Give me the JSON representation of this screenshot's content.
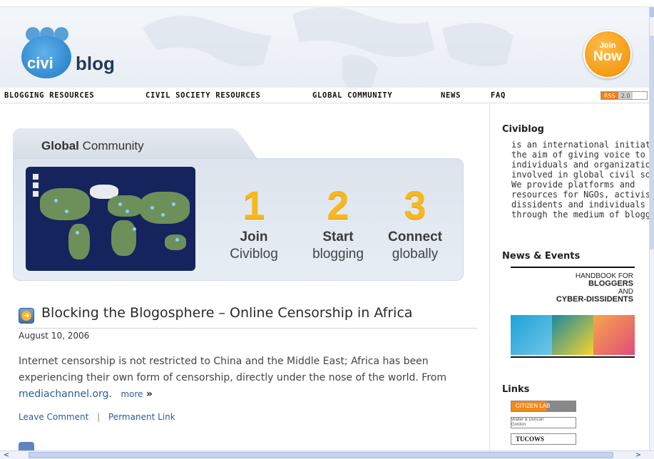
{
  "header": {
    "logo_civi": "civi",
    "logo_blog": "blog",
    "join_top": "Join",
    "join_bottom": "Now"
  },
  "nav": {
    "items": [
      "BLOGGING RESOURCES",
      "CIVIL SOCIETY RESOURCES",
      "GLOBAL COMMUNITY",
      "NEWS",
      "FAQ"
    ],
    "rss_left": "RSS",
    "rss_right": "2.0"
  },
  "global_community": {
    "title_bold": "Global",
    "title_rest": "Community",
    "steps": [
      {
        "num": "1",
        "line1": "Join",
        "line2": "Civiblog"
      },
      {
        "num": "2",
        "line1": "Start",
        "line2": "blogging"
      },
      {
        "num": "3",
        "line1": "Connect",
        "line2": "globally"
      }
    ]
  },
  "post": {
    "title": "Blocking the Blogosphere – Online Censorship in Africa",
    "date": "August 10, 2006",
    "body_before_link": "Internet censorship is not restricted to China and the Middle East; Africa has been experiencing their own form of censorship, directly under the nose of the world. From ",
    "link_text": "mediachannel.org",
    "body_after_link": ".",
    "more": "more",
    "more_arrow": "»",
    "leave_comment": "Leave Comment",
    "separator": "|",
    "permanent_link": "Permanent Link"
  },
  "sidebar": {
    "civiblog_heading": "Civiblog",
    "civiblog_lines": [
      "is an international initiative wi",
      "the aim of giving voice to",
      "individuals and organizations",
      "involved in global civil society",
      "We provide platforms and",
      "resources for NGOs, activists,",
      "dissidents and individuals at r",
      "through the medium of bloggi"
    ],
    "news_heading": "News & Events",
    "book_line1": "HANDBOOK FOR",
    "book_line2": "BLOGGERS",
    "book_line3": "AND",
    "book_line4": "CYBER-DISSIDENTS",
    "links_heading": "Links",
    "link_logos": [
      "CITIZEN LAB",
      "Walter & Duncan Gordon FOUNDATION",
      "TUCOWS"
    ]
  }
}
